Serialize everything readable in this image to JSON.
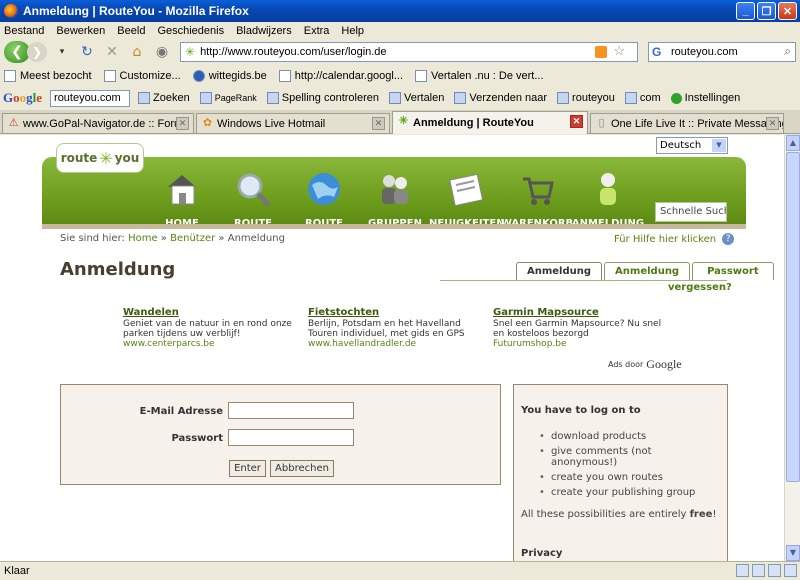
{
  "window": {
    "title": "Anmeldung | RouteYou - Mozilla Firefox"
  },
  "menu": [
    "Bestand",
    "Bewerken",
    "Beeld",
    "Geschiedenis",
    "Bladwijzers",
    "Extra",
    "Help"
  ],
  "nav": {
    "url": "http://www.routeyou.com/user/login.de",
    "search_value": "routeyou.com"
  },
  "bookmarks": [
    "Meest bezocht",
    "Customize...",
    "wittegids.be",
    "http://calendar.googl...",
    "Vertalen .nu : De vert..."
  ],
  "google_toolbar": {
    "logo": "Google",
    "search_value": "routeyou.com",
    "items": [
      "Zoeken",
      "PageRank",
      "Spelling controleren",
      "Vertalen",
      "Verzenden naar",
      "routeyou",
      "com",
      "Instellingen"
    ]
  },
  "tabs": [
    {
      "label": "www.GoPal-Navigator.de :: Forum anz...",
      "icon": "warning-icon",
      "active": false
    },
    {
      "label": "Windows Live Hotmail",
      "icon": "msn-icon",
      "active": false
    },
    {
      "label": "Anmeldung | RouteYou",
      "icon": "routeyou-icon",
      "active": true
    },
    {
      "label": "One Life Live It :: Private Messaging",
      "icon": "page-icon",
      "active": false
    }
  ],
  "site": {
    "logo_left": "route",
    "logo_right": "you",
    "language": "Deutsch",
    "nav": [
      "HOME",
      "ROUTE SUCHEN",
      "ROUTE ERSTELLEN",
      "GRUPPEN",
      "NEUIGKEITEN",
      "WARENKORB",
      "ANMELDUNG"
    ],
    "quick_search": "Schnelle Suche",
    "breadcrumb": {
      "prefix": "Sie sind hier:",
      "home": "Home",
      "sep": "»",
      "users": "Benützer",
      "current": "Anmeldung"
    },
    "help": "Für Hilfe hier klicken",
    "heading": "Anmeldung",
    "tabs": [
      "Anmeldung",
      "Anmeldung",
      "Passwort"
    ],
    "forgot": "vergessen?",
    "ads": [
      {
        "title": "Wandelen",
        "line1": "Geniet van de natuur in en rond onze",
        "line2": "parken tijdens uw verblijf!",
        "url": "www.centerparcs.be"
      },
      {
        "title": "Fietstochten",
        "line1": "Berlijn, Potsdam en het Havelland",
        "line2": "Touren individuel, met gids en GPS",
        "url": "www.havellandradler.de"
      },
      {
        "title": "Garmin Mapsource",
        "line1": "Snel een Garmin Mapsource? Nu snel",
        "line2": "en kosteloos bezorgd",
        "url": "Futurumshop.be"
      }
    ],
    "ads_by": "Ads door",
    "ads_google": "Google",
    "login": {
      "email_label": "E-Mail Adresse",
      "password_label": "Passwort",
      "enter": "Enter",
      "cancel": "Abbrechen"
    },
    "info": {
      "heading": "You have to log on to",
      "items": [
        "download products",
        "give comments (not anonymous!)",
        "create you own routes",
        "create your publishing group"
      ],
      "all_prefix": "All these possibilities are entirely ",
      "all_bold": "free",
      "all_suffix": "!",
      "privacy": "Privacy"
    }
  },
  "status": "Klaar"
}
